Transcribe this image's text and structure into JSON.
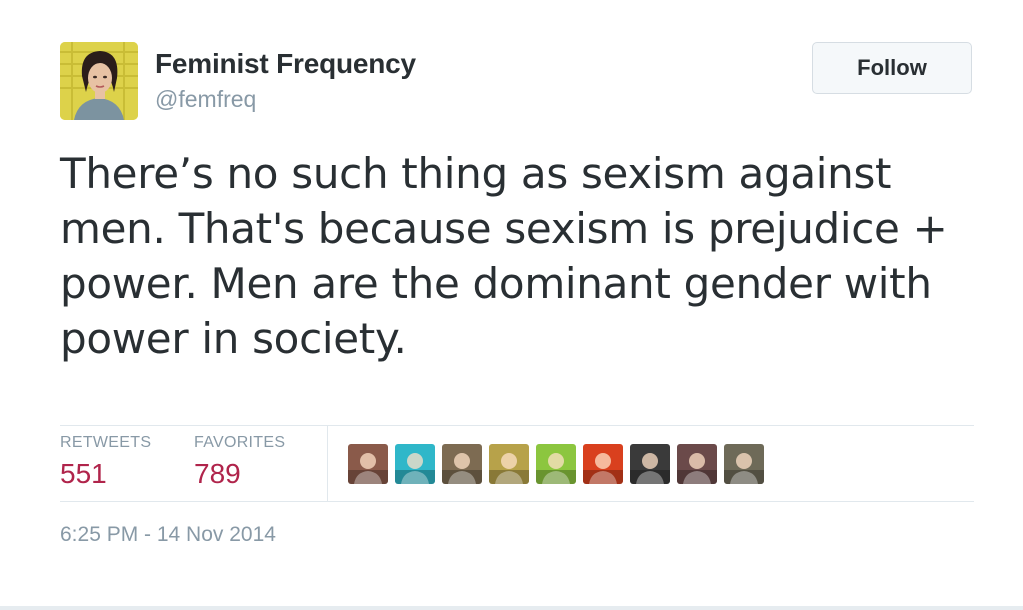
{
  "author": {
    "display_name": "Feminist Frequency",
    "screen_name": "@femfreq",
    "avatar_icon": "user-avatar-photo"
  },
  "follow_button": {
    "label": "Follow"
  },
  "tweet": {
    "text": "There’s no such thing as sexism against men. That's because sexism is prejudice + power. Men are the dominant gender with power in society."
  },
  "stats": {
    "retweets_label": "RETWEETS",
    "retweets_count": "551",
    "favorites_label": "FAVORITES",
    "favorites_count": "789"
  },
  "favoriters": [
    {
      "icon": "favoriter-avatar-1",
      "color": "#8a5a4a"
    },
    {
      "icon": "favoriter-avatar-2",
      "color": "#2fb7c9"
    },
    {
      "icon": "favoriter-avatar-3",
      "color": "#7d6b52"
    },
    {
      "icon": "favoriter-avatar-4",
      "color": "#b7a24a"
    },
    {
      "icon": "favoriter-avatar-5",
      "color": "#8cc63f"
    },
    {
      "icon": "favoriter-avatar-6",
      "color": "#d9401e"
    },
    {
      "icon": "favoriter-avatar-7",
      "color": "#3a3a3a"
    },
    {
      "icon": "favoriter-avatar-8",
      "color": "#6b4a4a"
    },
    {
      "icon": "favoriter-avatar-9",
      "color": "#6e6a58"
    }
  ],
  "timestamp": "6:25 PM - 14 Nov 2014",
  "colors": {
    "accent_count": "#b0244b",
    "muted_text": "#8899a6",
    "primary_text": "#292f33",
    "divider": "#e1e8ed"
  }
}
